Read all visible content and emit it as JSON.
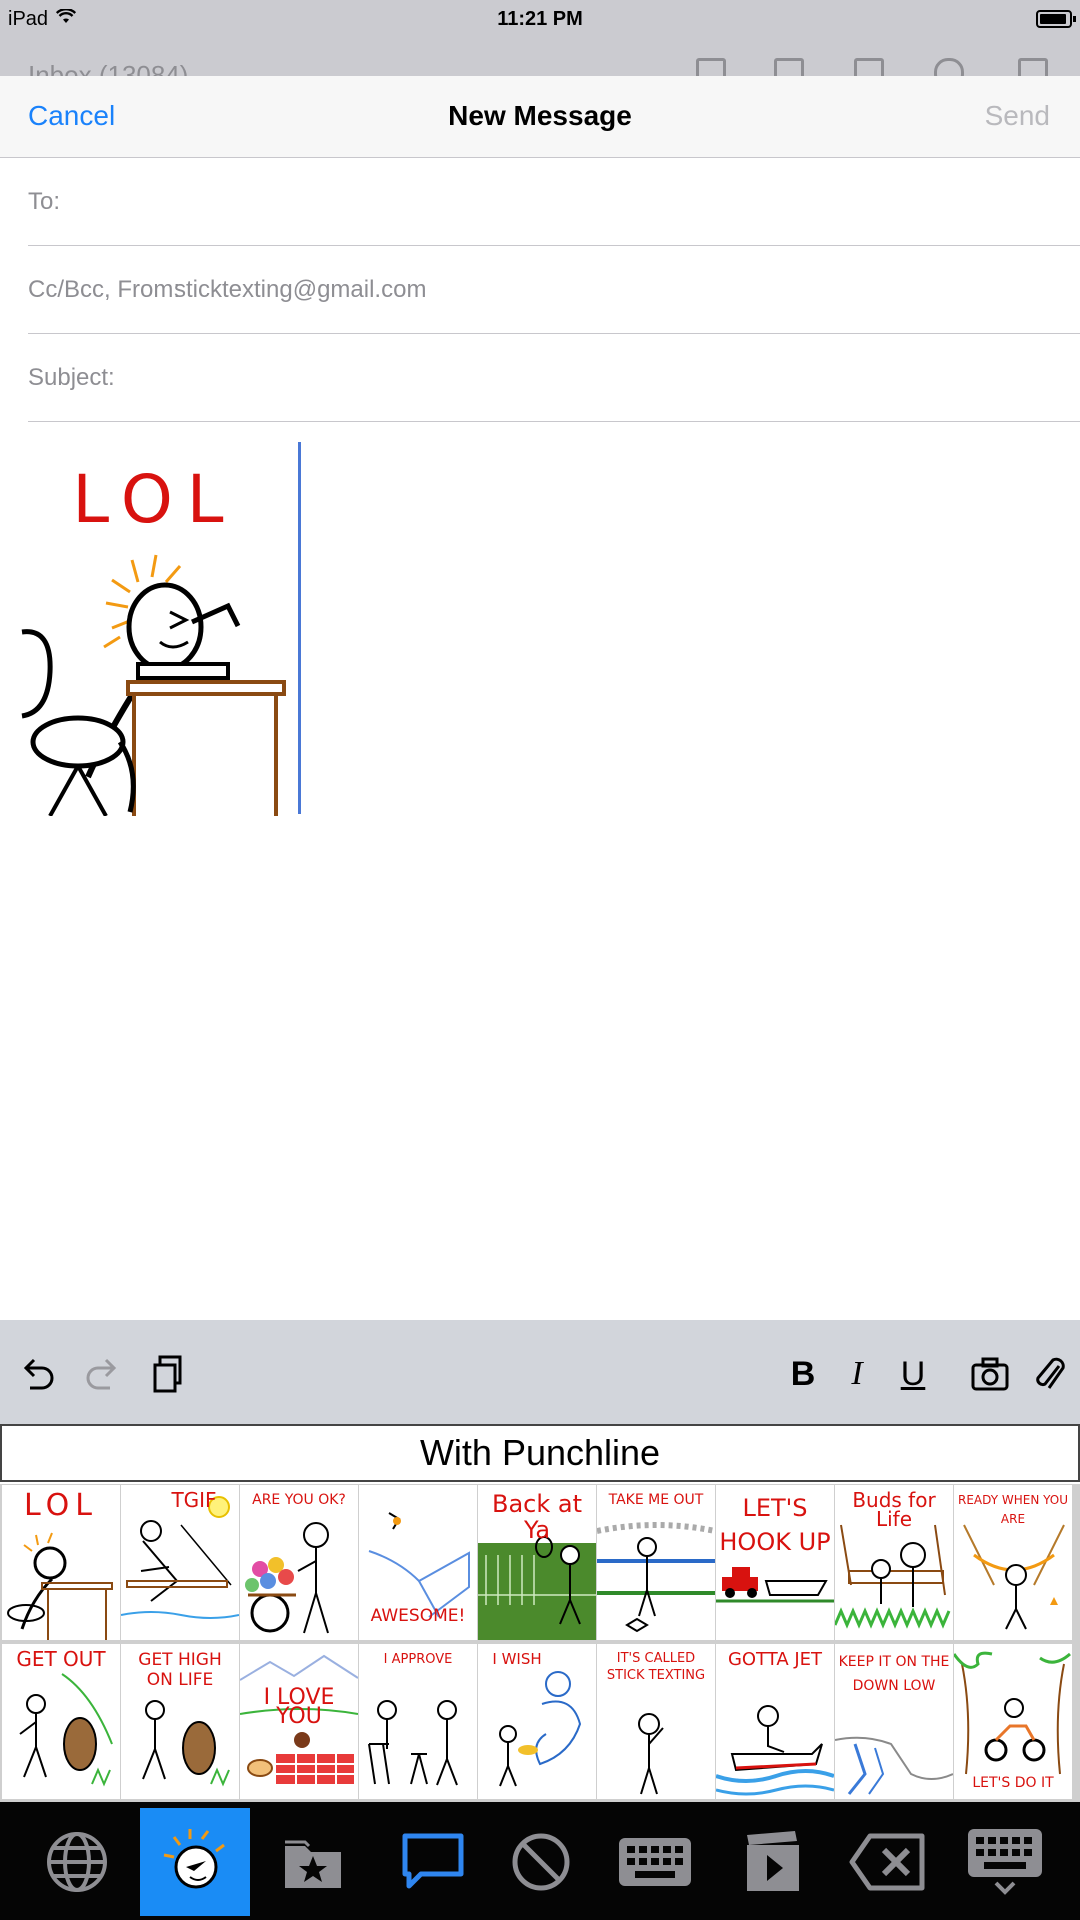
{
  "status_bar": {
    "device": "iPad",
    "time": "11:21 PM"
  },
  "behind_toolbar": {
    "mailbox_label": "Inbox (13084)"
  },
  "compose": {
    "cancel_label": "Cancel",
    "title": "New Message",
    "send_label": "Send",
    "to_label": "To:",
    "ccbcc_label": "Cc/Bcc, From:",
    "from_value": "sticktexting@gmail.com",
    "subject_label": "Subject:",
    "body_sticker_caption": "LOL"
  },
  "format_bar": {
    "bold_label": "B",
    "italic_label": "I",
    "underline_label": "U"
  },
  "sticker_keyboard": {
    "category_title": "With Punchline",
    "stickers": [
      {
        "caption": "LOL"
      },
      {
        "caption": "TGIF"
      },
      {
        "caption": "ARE YOU OK?"
      },
      {
        "caption": "AWESOME!"
      },
      {
        "caption": "Back at Ya"
      },
      {
        "caption": "TAKE ME OUT"
      },
      {
        "caption": "LET'S HOOK UP"
      },
      {
        "caption": "Buds for Life"
      },
      {
        "caption": "READY WHEN YOU ARE"
      },
      {
        "caption": "GET OUT"
      },
      {
        "caption": "GET HIGH ON LIFE"
      },
      {
        "caption": "I LOVE YOU"
      },
      {
        "caption": "I APPROVE"
      },
      {
        "caption": "I WISH"
      },
      {
        "caption": "IT'S CALLED STICK TEXTING"
      },
      {
        "caption": "GOTTA JET"
      },
      {
        "caption": "KEEP IT ON THE DOWN LOW"
      },
      {
        "caption": "LET'S DO IT"
      }
    ]
  },
  "dock": {
    "keys": [
      {
        "icon": "globe-icon"
      },
      {
        "icon": "stick-face-icon",
        "active": true
      },
      {
        "icon": "favorites-folder-icon"
      },
      {
        "icon": "chat-bubble-icon"
      },
      {
        "icon": "prohibited-icon"
      },
      {
        "icon": "keyboard-icon"
      },
      {
        "icon": "video-clip-icon"
      },
      {
        "icon": "delete-icon"
      },
      {
        "icon": "hide-keyboard-icon"
      }
    ],
    "active_color": "#1a8cf5"
  },
  "colors": {
    "link_blue": "#1a82fb",
    "caption_red": "#d8120f",
    "caret_blue": "#4a78d6"
  }
}
